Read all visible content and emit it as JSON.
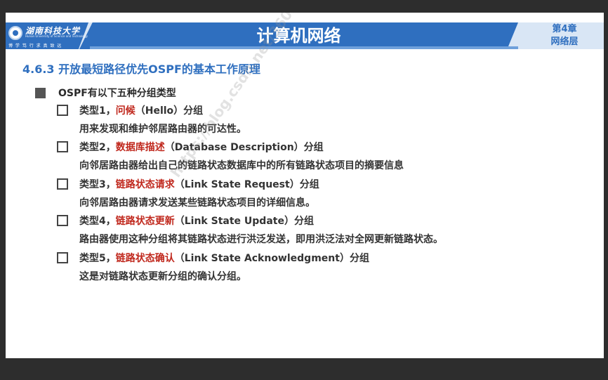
{
  "header": {
    "university_name": "湖南科技大学",
    "university_name_en": "Hunan University of Science and Technology",
    "motto": "博 学 笃 行   求 真 致 远",
    "title": "计算机网络",
    "chapter_line1": "第4章",
    "chapter_line2": "网络层"
  },
  "section": {
    "heading": "4.6.3 开放最短路径优先OSPF的基本工作原理"
  },
  "main": {
    "intro": "OSPF有以下五种分组类型",
    "items": [
      {
        "prefix": "类型1，",
        "keyword": "问候",
        "suffix": "（Hello）分组",
        "desc": "用来发现和维护邻居路由器的可达性。"
      },
      {
        "prefix": "类型2，",
        "keyword": "数据库描述",
        "suffix": "（Database Description）分组",
        "desc": "向邻居路由器给出自己的链路状态数据库中的所有链路状态项目的摘要信息"
      },
      {
        "prefix": "类型3，",
        "keyword": "链路状态请求",
        "suffix": "（Link State Request）分组",
        "desc": "向邻居路由器请求发送某些链路状态项目的详细信息。"
      },
      {
        "prefix": "类型4，",
        "keyword": "链路状态更新",
        "suffix": "（Link State Update）分组",
        "desc": "路由器使用这种分组将其链路状态进行洪泛发送，即用洪泛法对全网更新链路状态。"
      },
      {
        "prefix": "类型5，",
        "keyword": "链路状态确认",
        "suffix": "（Link State Acknowledgment）分组",
        "desc": "这是对链路状态更新分组的确认分组。"
      }
    ]
  },
  "watermark": "https://blog.csdn.net/360996402",
  "colors": {
    "header_blue": "#2f6fbf",
    "keyword_red": "#c0281d",
    "text": "#333333"
  }
}
